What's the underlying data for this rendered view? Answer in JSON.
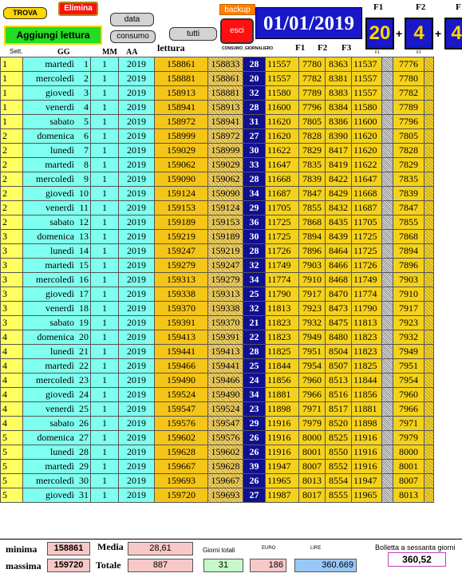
{
  "toolbar": {
    "trova": "TROVA",
    "elimina": "Elimina",
    "data": "data",
    "consumo": "consumo",
    "tutti": "tutti",
    "aggiungi": "Aggiungi lettura",
    "backup": "backup",
    "esci": "esci"
  },
  "current_date": "01/01/2019",
  "fascia": {
    "f1_label": "F1",
    "f2_label": "F2",
    "f3_label": "F",
    "f1": "20",
    "f2": "4",
    "f3": "4",
    "plus": "+",
    "f1_small": "F1",
    "f2_small": "F2"
  },
  "headers": {
    "sett": "Sett.",
    "gg": "GG",
    "mm": "MM",
    "aa": "AA",
    "lettura": "lettura",
    "consumo_giornaliero": "CONSUMO_GIORNALIERO",
    "f1": "F1",
    "f2": "F2",
    "f3": "F3"
  },
  "rows": [
    {
      "sett": "1",
      "gg": "martedì",
      "d": "1",
      "mm": "1",
      "aa": "2019",
      "let": "158861",
      "prev": "158833",
      "cons": "28",
      "f1": "11557",
      "f2": "7780",
      "f3": "8363",
      "pf1": "11537",
      "pf2": "7776"
    },
    {
      "sett": "1",
      "gg": "mercoledì",
      "d": "2",
      "mm": "1",
      "aa": "2019",
      "let": "158881",
      "prev": "158861",
      "cons": "20",
      "f1": "11557",
      "f2": "7782",
      "f3": "8381",
      "pf1": "11557",
      "pf2": "7780"
    },
    {
      "sett": "1",
      "gg": "giovedì",
      "d": "3",
      "mm": "1",
      "aa": "2019",
      "let": "158913",
      "prev": "158881",
      "cons": "32",
      "f1": "11580",
      "f2": "7789",
      "f3": "8383",
      "pf1": "11557",
      "pf2": "7782"
    },
    {
      "sett": "1",
      "gg": "venerdì",
      "d": "4",
      "mm": "1",
      "aa": "2019",
      "let": "158941",
      "prev": "158913",
      "cons": "28",
      "f1": "11600",
      "f2": "7796",
      "f3": "8384",
      "pf1": "11580",
      "pf2": "7789"
    },
    {
      "sett": "1",
      "gg": "sabato",
      "d": "5",
      "mm": "1",
      "aa": "2019",
      "let": "158972",
      "prev": "158941",
      "cons": "31",
      "f1": "11620",
      "f2": "7805",
      "f3": "8386",
      "pf1": "11600",
      "pf2": "7796"
    },
    {
      "sett": "2",
      "gg": "domenica",
      "d": "6",
      "mm": "1",
      "aa": "2019",
      "let": "158999",
      "prev": "158972",
      "cons": "27",
      "f1": "11620",
      "f2": "7828",
      "f3": "8390",
      "pf1": "11620",
      "pf2": "7805"
    },
    {
      "sett": "2",
      "gg": "lunedì",
      "d": "7",
      "mm": "1",
      "aa": "2019",
      "let": "159029",
      "prev": "158999",
      "cons": "30",
      "f1": "11622",
      "f2": "7829",
      "f3": "8417",
      "pf1": "11620",
      "pf2": "7828"
    },
    {
      "sett": "2",
      "gg": "martedì",
      "d": "8",
      "mm": "1",
      "aa": "2019",
      "let": "159062",
      "prev": "159029",
      "cons": "33",
      "f1": "11647",
      "f2": "7835",
      "f3": "8419",
      "pf1": "11622",
      "pf2": "7829"
    },
    {
      "sett": "2",
      "gg": "mercoledì",
      "d": "9",
      "mm": "1",
      "aa": "2019",
      "let": "159090",
      "prev": "159062",
      "cons": "28",
      "f1": "11668",
      "f2": "7839",
      "f3": "8422",
      "pf1": "11647",
      "pf2": "7835"
    },
    {
      "sett": "2",
      "gg": "giovedì",
      "d": "10",
      "mm": "1",
      "aa": "2019",
      "let": "159124",
      "prev": "159090",
      "cons": "34",
      "f1": "11687",
      "f2": "7847",
      "f3": "8429",
      "pf1": "11668",
      "pf2": "7839"
    },
    {
      "sett": "2",
      "gg": "venerdì",
      "d": "11",
      "mm": "1",
      "aa": "2019",
      "let": "159153",
      "prev": "159124",
      "cons": "29",
      "f1": "11705",
      "f2": "7855",
      "f3": "8432",
      "pf1": "11687",
      "pf2": "7847"
    },
    {
      "sett": "2",
      "gg": "sabato",
      "d": "12",
      "mm": "1",
      "aa": "2019",
      "let": "159189",
      "prev": "159153",
      "cons": "36",
      "f1": "11725",
      "f2": "7868",
      "f3": "8435",
      "pf1": "11705",
      "pf2": "7855"
    },
    {
      "sett": "3",
      "gg": "domenica",
      "d": "13",
      "mm": "1",
      "aa": "2019",
      "let": "159219",
      "prev": "159189",
      "cons": "30",
      "f1": "11725",
      "f2": "7894",
      "f3": "8439",
      "pf1": "11725",
      "pf2": "7868"
    },
    {
      "sett": "3",
      "gg": "lunedì",
      "d": "14",
      "mm": "1",
      "aa": "2019",
      "let": "159247",
      "prev": "159219",
      "cons": "28",
      "f1": "11726",
      "f2": "7896",
      "f3": "8464",
      "pf1": "11725",
      "pf2": "7894"
    },
    {
      "sett": "3",
      "gg": "martedì",
      "d": "15",
      "mm": "1",
      "aa": "2019",
      "let": "159279",
      "prev": "159247",
      "cons": "32",
      "f1": "11749",
      "f2": "7903",
      "f3": "8466",
      "pf1": "11726",
      "pf2": "7896"
    },
    {
      "sett": "3",
      "gg": "mercoledì",
      "d": "16",
      "mm": "1",
      "aa": "2019",
      "let": "159313",
      "prev": "159279",
      "cons": "34",
      "f1": "11774",
      "f2": "7910",
      "f3": "8468",
      "pf1": "11749",
      "pf2": "7903"
    },
    {
      "sett": "3",
      "gg": "giovedì",
      "d": "17",
      "mm": "1",
      "aa": "2019",
      "let": "159338",
      "prev": "159313",
      "cons": "25",
      "f1": "11790",
      "f2": "7917",
      "f3": "8470",
      "pf1": "11774",
      "pf2": "7910"
    },
    {
      "sett": "3",
      "gg": "venerdì",
      "d": "18",
      "mm": "1",
      "aa": "2019",
      "let": "159370",
      "prev": "159338",
      "cons": "32",
      "f1": "11813",
      "f2": "7923",
      "f3": "8473",
      "pf1": "11790",
      "pf2": "7917"
    },
    {
      "sett": "3",
      "gg": "sabato",
      "d": "19",
      "mm": "1",
      "aa": "2019",
      "let": "159391",
      "prev": "159370",
      "cons": "21",
      "f1": "11823",
      "f2": "7932",
      "f3": "8475",
      "pf1": "11813",
      "pf2": "7923"
    },
    {
      "sett": "4",
      "gg": "domenica",
      "d": "20",
      "mm": "1",
      "aa": "2019",
      "let": "159413",
      "prev": "159391",
      "cons": "22",
      "f1": "11823",
      "f2": "7949",
      "f3": "8480",
      "pf1": "11823",
      "pf2": "7932"
    },
    {
      "sett": "4",
      "gg": "lunedì",
      "d": "21",
      "mm": "1",
      "aa": "2019",
      "let": "159441",
      "prev": "159413",
      "cons": "28",
      "f1": "11825",
      "f2": "7951",
      "f3": "8504",
      "pf1": "11823",
      "pf2": "7949"
    },
    {
      "sett": "4",
      "gg": "martedì",
      "d": "22",
      "mm": "1",
      "aa": "2019",
      "let": "159466",
      "prev": "159441",
      "cons": "25",
      "f1": "11844",
      "f2": "7954",
      "f3": "8507",
      "pf1": "11825",
      "pf2": "7951"
    },
    {
      "sett": "4",
      "gg": "mercoledì",
      "d": "23",
      "mm": "1",
      "aa": "2019",
      "let": "159490",
      "prev": "159466",
      "cons": "24",
      "f1": "11856",
      "f2": "7960",
      "f3": "8513",
      "pf1": "11844",
      "pf2": "7954"
    },
    {
      "sett": "4",
      "gg": "giovedì",
      "d": "24",
      "mm": "1",
      "aa": "2019",
      "let": "159524",
      "prev": "159490",
      "cons": "34",
      "f1": "11881",
      "f2": "7966",
      "f3": "8516",
      "pf1": "11856",
      "pf2": "7960"
    },
    {
      "sett": "4",
      "gg": "venerdì",
      "d": "25",
      "mm": "1",
      "aa": "2019",
      "let": "159547",
      "prev": "159524",
      "cons": "23",
      "f1": "11898",
      "f2": "7971",
      "f3": "8517",
      "pf1": "11881",
      "pf2": "7966"
    },
    {
      "sett": "4",
      "gg": "sabato",
      "d": "26",
      "mm": "1",
      "aa": "2019",
      "let": "159576",
      "prev": "159547",
      "cons": "29",
      "f1": "11916",
      "f2": "7979",
      "f3": "8520",
      "pf1": "11898",
      "pf2": "7971"
    },
    {
      "sett": "5",
      "gg": "domenica",
      "d": "27",
      "mm": "1",
      "aa": "2019",
      "let": "159602",
      "prev": "159576",
      "cons": "26",
      "f1": "11916",
      "f2": "8000",
      "f3": "8525",
      "pf1": "11916",
      "pf2": "7979"
    },
    {
      "sett": "5",
      "gg": "lunedì",
      "d": "28",
      "mm": "1",
      "aa": "2019",
      "let": "159628",
      "prev": "159602",
      "cons": "26",
      "f1": "11916",
      "f2": "8001",
      "f3": "8550",
      "pf1": "11916",
      "pf2": "8000"
    },
    {
      "sett": "5",
      "gg": "martedì",
      "d": "29",
      "mm": "1",
      "aa": "2019",
      "let": "159667",
      "prev": "159628",
      "cons": "39",
      "f1": "11947",
      "f2": "8007",
      "f3": "8552",
      "pf1": "11916",
      "pf2": "8001"
    },
    {
      "sett": "5",
      "gg": "mercoledì",
      "d": "30",
      "mm": "1",
      "aa": "2019",
      "let": "159693",
      "prev": "159667",
      "cons": "26",
      "f1": "11965",
      "f2": "8013",
      "f3": "8554",
      "pf1": "11947",
      "pf2": "8007"
    },
    {
      "sett": "5",
      "gg": "giovedì",
      "d": "31",
      "mm": "1",
      "aa": "2019",
      "let": "159720",
      "prev": "159693",
      "cons": "27",
      "f1": "11987",
      "f2": "8017",
      "f3": "8555",
      "pf1": "11965",
      "pf2": "8013"
    }
  ],
  "summary": {
    "minima_label": "minima",
    "minima": "158861",
    "massima_label": "massima",
    "massima": "159720",
    "media_label": "Media",
    "media": "28,61",
    "totale_label": "Totale",
    "totale": "887",
    "giorni_label": "Giorni totali",
    "giorni": "31",
    "euro_label": "EURO",
    "euro": "186",
    "lire_label": "LIRE",
    "lire": "360.669",
    "bolletta_label": "Bolletta a sessanta giorni",
    "bolletta": "360,52"
  }
}
